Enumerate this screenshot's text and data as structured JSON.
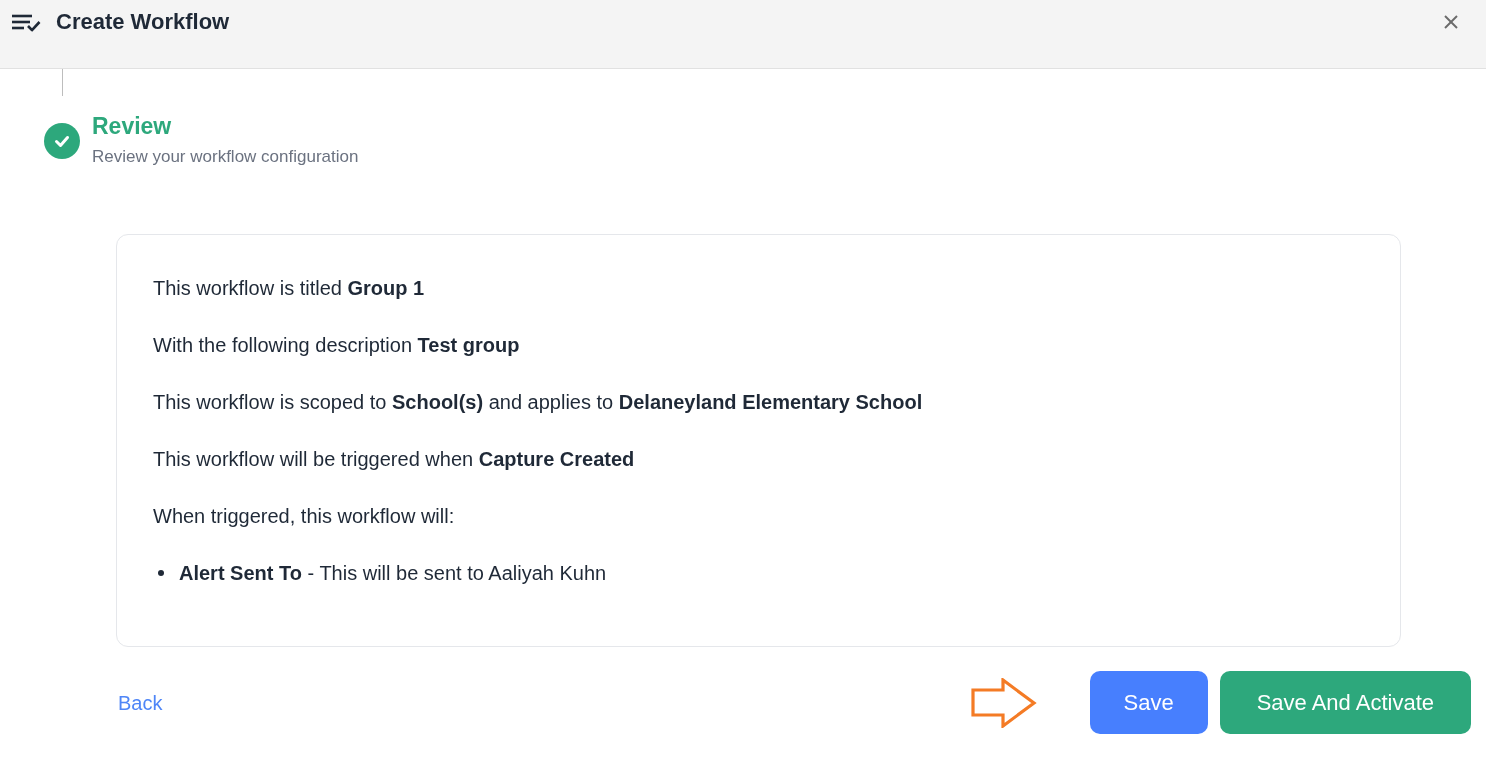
{
  "header": {
    "title": "Create Workflow"
  },
  "step": {
    "title": "Review",
    "subtitle": "Review your workflow configuration",
    "completed": true
  },
  "summary": {
    "lines": [
      "This workflow is titled **Group 1**",
      "With the following description **Test group**",
      "This workflow is scoped to **School(s)** and applies to **Delaneyland Elementary School**",
      "This workflow will be triggered when **Capture Created**",
      "When triggered, this workflow will:"
    ],
    "actions": [
      "**Alert Sent To** - This will be sent to Aaliyah Kuhn"
    ]
  },
  "footer": {
    "back_link": "Back",
    "buttons": [
      {
        "label": "Save",
        "kind": "primary"
      },
      {
        "label": "Save And Activate",
        "kind": "success"
      }
    ]
  }
}
